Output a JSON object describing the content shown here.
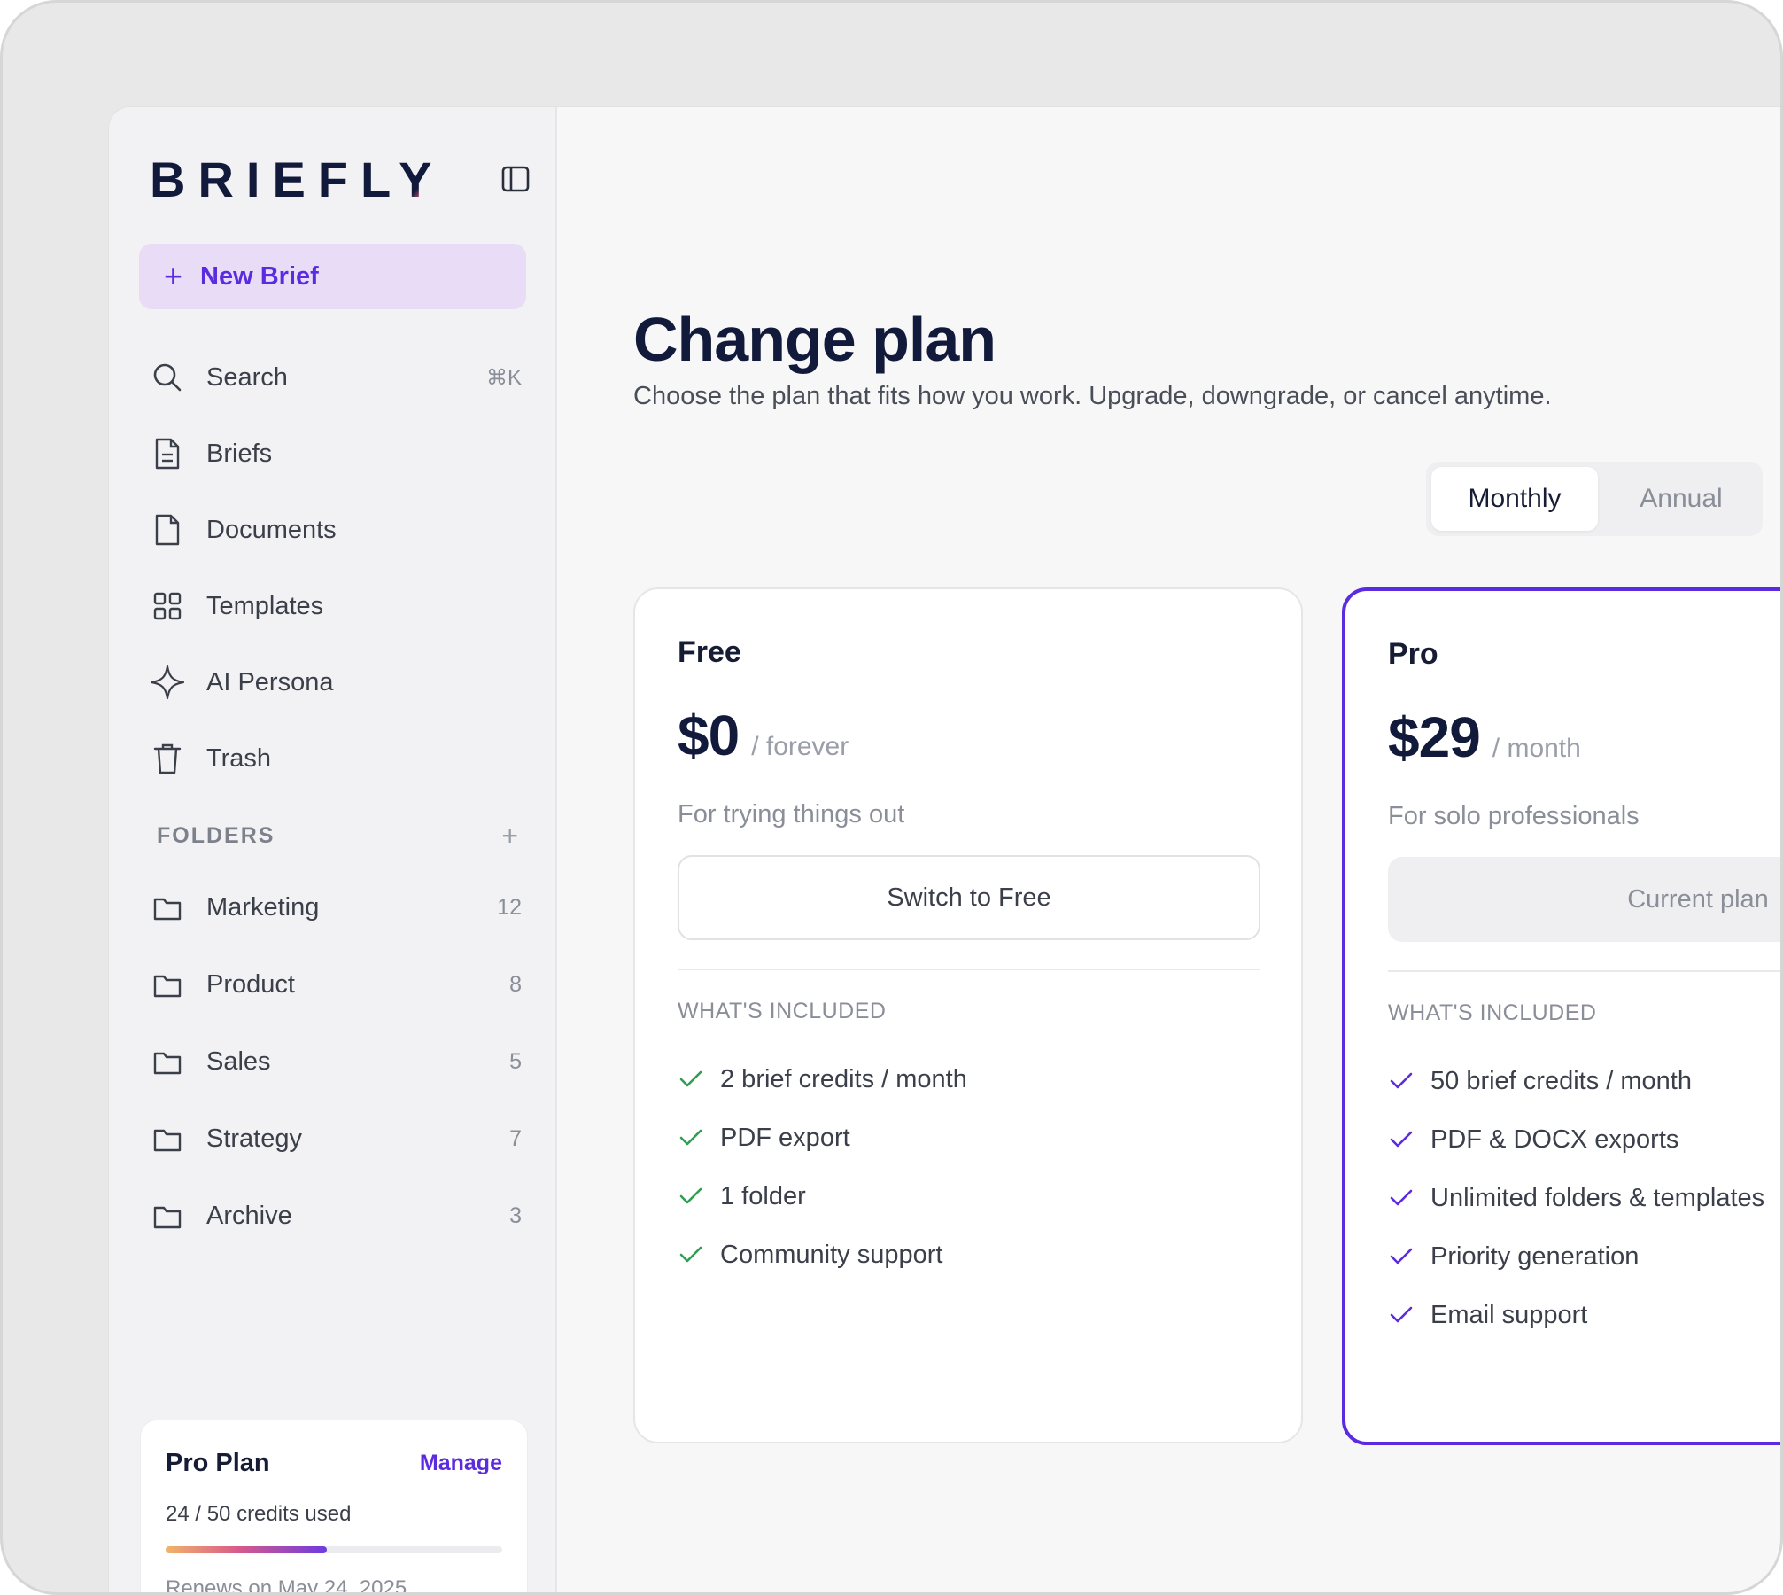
{
  "brand": {
    "name": "BRIEFL",
    "accent_letter": "Y"
  },
  "sidebar": {
    "new_brief": "New Brief",
    "nav": [
      {
        "label": "Search",
        "icon": "search-icon",
        "hint": "⌘K"
      },
      {
        "label": "Briefs",
        "icon": "brief-doc-icon"
      },
      {
        "label": "Documents",
        "icon": "document-icon"
      },
      {
        "label": "Templates",
        "icon": "grid-icon"
      },
      {
        "label": "AI Persona",
        "icon": "sparkle-icon"
      },
      {
        "label": "Trash",
        "icon": "trash-icon"
      }
    ],
    "folders_heading": "FOLDERS",
    "folders": [
      {
        "label": "Marketing",
        "count": "12"
      },
      {
        "label": "Product",
        "count": "8"
      },
      {
        "label": "Sales",
        "count": "5"
      },
      {
        "label": "Strategy",
        "count": "7"
      },
      {
        "label": "Archive",
        "count": "3"
      }
    ],
    "plan": {
      "title": "Pro Plan",
      "manage": "Manage",
      "usage": "24 / 50 credits used",
      "usage_fraction": 0.48,
      "renews": "Renews on May 24, 2025"
    }
  },
  "main": {
    "title": "Change plan",
    "subtitle": "Choose the plan that fits how you work. Upgrade, downgrade, or cancel anytime.",
    "billing": {
      "monthly": "Monthly",
      "annual": "Annual",
      "selected": "Monthly"
    },
    "plans": [
      {
        "name": "Free",
        "price": "$0",
        "period": "/ forever",
        "description": "For trying things out",
        "cta": "Switch to Free",
        "included_heading": "WHAT'S INCLUDED",
        "features": [
          "2 brief credits / month",
          "PDF export",
          "1 folder",
          "Community support"
        ]
      },
      {
        "name": "Pro",
        "price": "$29",
        "period": "/ month",
        "description": "For solo professionals",
        "cta": "Current plan",
        "included_heading": "WHAT'S INCLUDED",
        "features": [
          "50 brief credits / month",
          "PDF & DOCX exports",
          "Unlimited folders & templates",
          "Priority generation",
          "Email support"
        ]
      }
    ]
  },
  "colors": {
    "accent": "#5b2be0",
    "navy": "#111a3a",
    "check_free": "#2f9e52",
    "check_pro": "#5b2be0"
  }
}
